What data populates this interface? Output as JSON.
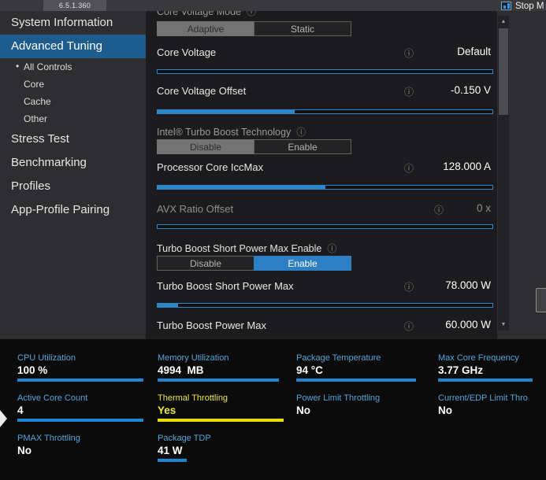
{
  "titlebar": {
    "version": "6.5.1.360",
    "stop_label": "Stop M"
  },
  "sidebar": {
    "bullet": "•",
    "items": [
      {
        "label": "System Information"
      },
      {
        "label": "Advanced Tuning",
        "selected": true
      },
      {
        "label": "All Controls"
      },
      {
        "label": "Core"
      },
      {
        "label": "Cache"
      },
      {
        "label": "Other"
      },
      {
        "label": "Stress Test"
      },
      {
        "label": "Benchmarking"
      },
      {
        "label": "Profiles"
      },
      {
        "label": "App-Profile Pairing"
      }
    ]
  },
  "panel": {
    "info_icon": "ⓘ",
    "scroll_up_icon": "▲",
    "scroll_down_icon": "▼",
    "controls": {
      "core_voltage_mode": {
        "label": "Core Voltage Mode"
      },
      "mode_toggle": {
        "options": [
          "Adaptive",
          "Static"
        ],
        "selected": "Adaptive"
      },
      "core_voltage": {
        "label": "Core Voltage",
        "value": "Default",
        "fill": 0
      },
      "core_voltage_offset": {
        "label": "Core Voltage Offset",
        "value": "-0.150 V",
        "fill": 41
      },
      "turbo_boost_tech": {
        "label": "Intel® Turbo Boost Technology"
      },
      "turbo_toggle": {
        "options": [
          "Disable",
          "Enable"
        ],
        "selected": "Disable"
      },
      "iccmax": {
        "label": "Processor Core IccMax",
        "value": "128.000 A",
        "fill": 50
      },
      "avx_ratio": {
        "label": "AVX Ratio Offset",
        "value": "0 x",
        "fill": 0
      },
      "short_power_enable": {
        "label": "Turbo Boost Short Power Max Enable"
      },
      "short_power_toggle": {
        "options": [
          "Disable",
          "Enable"
        ],
        "selected": "Enable"
      },
      "short_power": {
        "label": "Turbo Boost Short Power Max",
        "value": "78.000 W",
        "fill": 6
      },
      "power_max": {
        "label": "Turbo Boost Power Max",
        "value": "60.000 W"
      }
    }
  },
  "telemetry": {
    "cells": [
      {
        "label": "CPU Utilization",
        "value": "100 %",
        "bar": 100,
        "color": "blue"
      },
      {
        "label": "Memory Utilization",
        "value": "4994  MB",
        "bar": 96,
        "color": "blue"
      },
      {
        "label": "Package Temperature",
        "value": "94 °C",
        "bar": 95,
        "color": "blue"
      },
      {
        "label": "Max Core Frequency",
        "value": "3.77 GHz",
        "bar": 75,
        "color": "blue"
      },
      {
        "label": "Active Core Count",
        "value": "4",
        "bar": 100,
        "color": "blue"
      },
      {
        "label": "Thermal Throttling",
        "value": "Yes",
        "bar": 100,
        "color": "yellow"
      },
      {
        "label": "Power Limit Throttling",
        "value": "No",
        "bar": 0,
        "color": "blue"
      },
      {
        "label": "Current/EDP Limit Thro",
        "value": "No",
        "bar": 0,
        "color": "blue"
      },
      {
        "label": "PMAX Throttling",
        "value": "No",
        "bar": 0,
        "color": "blue"
      },
      {
        "label": "Package TDP",
        "value": "41 W",
        "bar": 23,
        "color": "blue"
      }
    ]
  },
  "colors": {
    "accent_blue": "#2b87c8",
    "telemetry_bar_blue": "#1b86d2",
    "telemetry_label_blue": "#57a4d8",
    "warning_yellow": "#eae845",
    "nav_selected_blue": "#1d5c8d"
  }
}
